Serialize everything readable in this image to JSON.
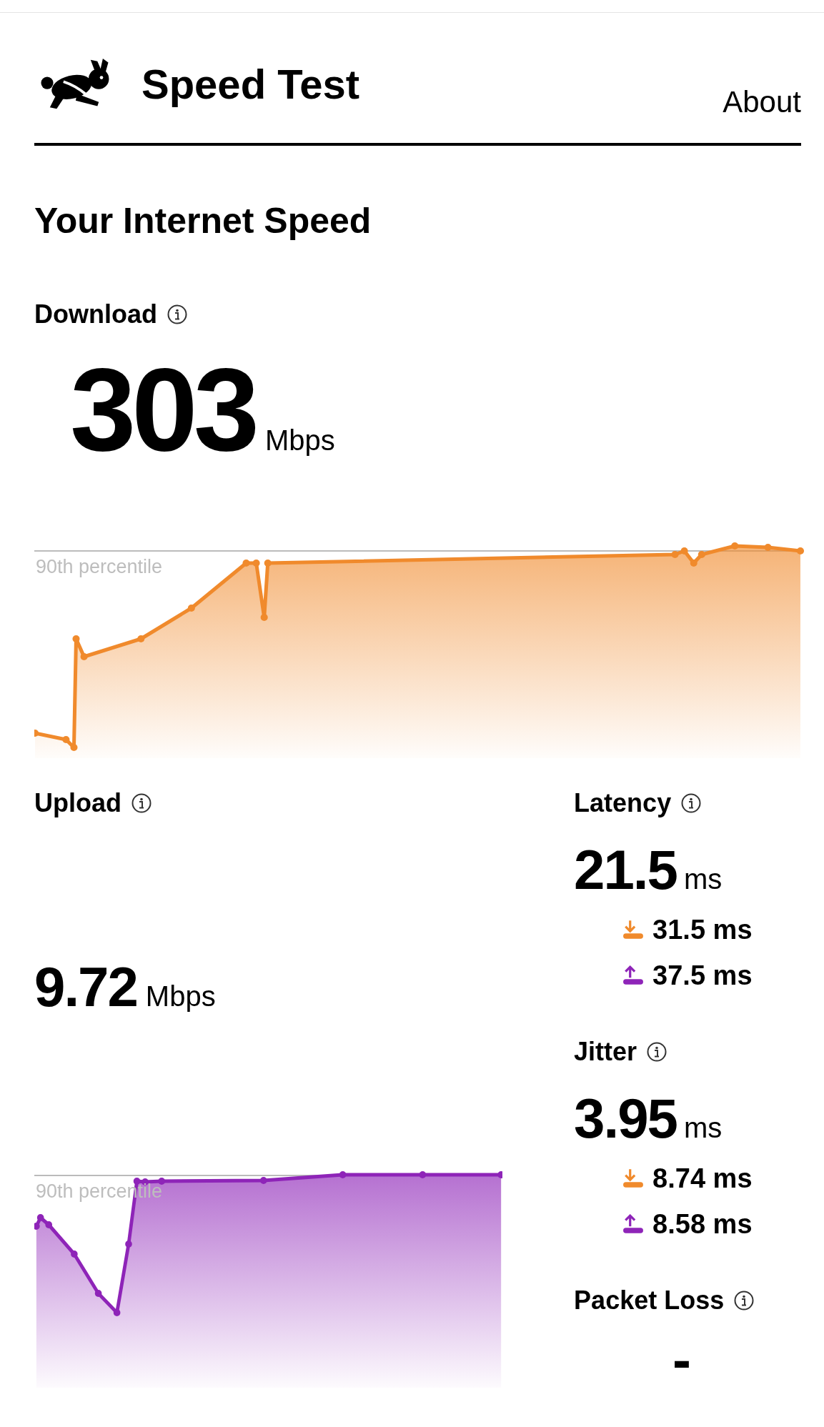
{
  "header": {
    "title": "Speed Test",
    "about": "About"
  },
  "heading": "Your Internet Speed",
  "download": {
    "label": "Download",
    "value": "303",
    "unit": "Mbps",
    "percentile_label": "90th percentile"
  },
  "upload": {
    "label": "Upload",
    "value": "9.72",
    "unit": "Mbps",
    "percentile_label": "90th percentile"
  },
  "metrics": [
    {
      "label": "Latency",
      "value": "21.5",
      "unit": "ms",
      "download": "31.5 ms",
      "upload": "37.5 ms"
    },
    {
      "label": "Jitter",
      "value": "3.95",
      "unit": "ms",
      "download": "8.74 ms",
      "upload": "8.58 ms"
    },
    {
      "label": "Packet Loss",
      "value": "-"
    }
  ]
}
